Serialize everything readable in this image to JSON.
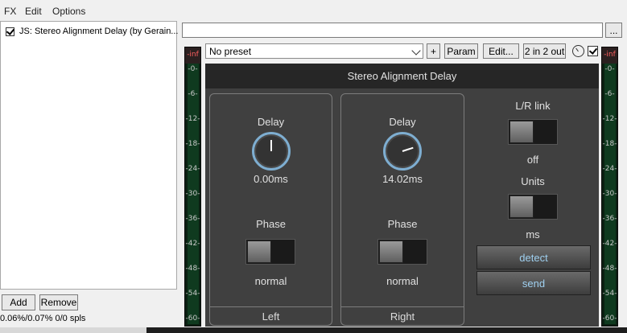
{
  "menu": {
    "fx": "FX",
    "edit": "Edit",
    "options": "Options"
  },
  "fx_list": {
    "items": [
      {
        "name": "JS: Stereo Alignment Delay (by Gerain...",
        "enabled": true
      }
    ]
  },
  "buttons": {
    "add": "Add",
    "remove": "Remove",
    "dots": "..."
  },
  "status": "0.06%/0.07% 0/0 spls",
  "preset": {
    "selected": "No preset"
  },
  "toolbar": {
    "plus": "+",
    "param": "Param",
    "edit": "Edit...",
    "io": "2 in 2 out"
  },
  "meter_labels": [
    "-inf",
    "-0-",
    "-6-",
    "-12-",
    "-18-",
    "-24-",
    "-30-",
    "-36-",
    "-42-",
    "-48-",
    "-54-",
    "-60-"
  ],
  "plugin": {
    "title": "Stereo Alignment Delay",
    "left": {
      "delay_label": "Delay",
      "delay_value": "0.00ms",
      "phase_label": "Phase",
      "phase_value": "normal",
      "footer": "Left"
    },
    "right": {
      "delay_label": "Delay",
      "delay_value": "14.02ms",
      "phase_label": "Phase",
      "phase_value": "normal",
      "footer": "Right"
    },
    "link": {
      "label": "L/R link",
      "value": "off"
    },
    "units": {
      "label": "Units",
      "value": "ms"
    },
    "detect": "detect",
    "send": "send"
  },
  "colors": {
    "accent": "#7eaed1",
    "panel_bg": "#404040",
    "title_bg": "#262626",
    "meter_inf": "#ff6060"
  }
}
